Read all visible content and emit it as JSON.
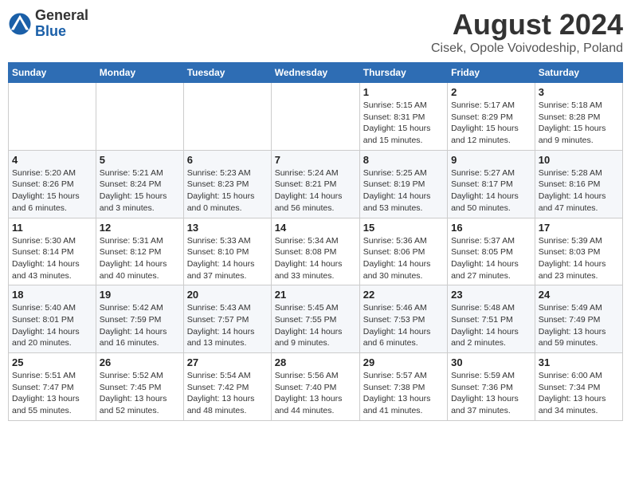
{
  "header": {
    "logo_general": "General",
    "logo_blue": "Blue",
    "main_title": "August 2024",
    "subtitle": "Cisek, Opole Voivodeship, Poland"
  },
  "calendar": {
    "days_of_week": [
      "Sunday",
      "Monday",
      "Tuesday",
      "Wednesday",
      "Thursday",
      "Friday",
      "Saturday"
    ],
    "weeks": [
      [
        {
          "day": "",
          "info": ""
        },
        {
          "day": "",
          "info": ""
        },
        {
          "day": "",
          "info": ""
        },
        {
          "day": "",
          "info": ""
        },
        {
          "day": "1",
          "info": "Sunrise: 5:15 AM\nSunset: 8:31 PM\nDaylight: 15 hours\nand 15 minutes."
        },
        {
          "day": "2",
          "info": "Sunrise: 5:17 AM\nSunset: 8:29 PM\nDaylight: 15 hours\nand 12 minutes."
        },
        {
          "day": "3",
          "info": "Sunrise: 5:18 AM\nSunset: 8:28 PM\nDaylight: 15 hours\nand 9 minutes."
        }
      ],
      [
        {
          "day": "4",
          "info": "Sunrise: 5:20 AM\nSunset: 8:26 PM\nDaylight: 15 hours\nand 6 minutes."
        },
        {
          "day": "5",
          "info": "Sunrise: 5:21 AM\nSunset: 8:24 PM\nDaylight: 15 hours\nand 3 minutes."
        },
        {
          "day": "6",
          "info": "Sunrise: 5:23 AM\nSunset: 8:23 PM\nDaylight: 15 hours\nand 0 minutes."
        },
        {
          "day": "7",
          "info": "Sunrise: 5:24 AM\nSunset: 8:21 PM\nDaylight: 14 hours\nand 56 minutes."
        },
        {
          "day": "8",
          "info": "Sunrise: 5:25 AM\nSunset: 8:19 PM\nDaylight: 14 hours\nand 53 minutes."
        },
        {
          "day": "9",
          "info": "Sunrise: 5:27 AM\nSunset: 8:17 PM\nDaylight: 14 hours\nand 50 minutes."
        },
        {
          "day": "10",
          "info": "Sunrise: 5:28 AM\nSunset: 8:16 PM\nDaylight: 14 hours\nand 47 minutes."
        }
      ],
      [
        {
          "day": "11",
          "info": "Sunrise: 5:30 AM\nSunset: 8:14 PM\nDaylight: 14 hours\nand 43 minutes."
        },
        {
          "day": "12",
          "info": "Sunrise: 5:31 AM\nSunset: 8:12 PM\nDaylight: 14 hours\nand 40 minutes."
        },
        {
          "day": "13",
          "info": "Sunrise: 5:33 AM\nSunset: 8:10 PM\nDaylight: 14 hours\nand 37 minutes."
        },
        {
          "day": "14",
          "info": "Sunrise: 5:34 AM\nSunset: 8:08 PM\nDaylight: 14 hours\nand 33 minutes."
        },
        {
          "day": "15",
          "info": "Sunrise: 5:36 AM\nSunset: 8:06 PM\nDaylight: 14 hours\nand 30 minutes."
        },
        {
          "day": "16",
          "info": "Sunrise: 5:37 AM\nSunset: 8:05 PM\nDaylight: 14 hours\nand 27 minutes."
        },
        {
          "day": "17",
          "info": "Sunrise: 5:39 AM\nSunset: 8:03 PM\nDaylight: 14 hours\nand 23 minutes."
        }
      ],
      [
        {
          "day": "18",
          "info": "Sunrise: 5:40 AM\nSunset: 8:01 PM\nDaylight: 14 hours\nand 20 minutes."
        },
        {
          "day": "19",
          "info": "Sunrise: 5:42 AM\nSunset: 7:59 PM\nDaylight: 14 hours\nand 16 minutes."
        },
        {
          "day": "20",
          "info": "Sunrise: 5:43 AM\nSunset: 7:57 PM\nDaylight: 14 hours\nand 13 minutes."
        },
        {
          "day": "21",
          "info": "Sunrise: 5:45 AM\nSunset: 7:55 PM\nDaylight: 14 hours\nand 9 minutes."
        },
        {
          "day": "22",
          "info": "Sunrise: 5:46 AM\nSunset: 7:53 PM\nDaylight: 14 hours\nand 6 minutes."
        },
        {
          "day": "23",
          "info": "Sunrise: 5:48 AM\nSunset: 7:51 PM\nDaylight: 14 hours\nand 2 minutes."
        },
        {
          "day": "24",
          "info": "Sunrise: 5:49 AM\nSunset: 7:49 PM\nDaylight: 13 hours\nand 59 minutes."
        }
      ],
      [
        {
          "day": "25",
          "info": "Sunrise: 5:51 AM\nSunset: 7:47 PM\nDaylight: 13 hours\nand 55 minutes."
        },
        {
          "day": "26",
          "info": "Sunrise: 5:52 AM\nSunset: 7:45 PM\nDaylight: 13 hours\nand 52 minutes."
        },
        {
          "day": "27",
          "info": "Sunrise: 5:54 AM\nSunset: 7:42 PM\nDaylight: 13 hours\nand 48 minutes."
        },
        {
          "day": "28",
          "info": "Sunrise: 5:56 AM\nSunset: 7:40 PM\nDaylight: 13 hours\nand 44 minutes."
        },
        {
          "day": "29",
          "info": "Sunrise: 5:57 AM\nSunset: 7:38 PM\nDaylight: 13 hours\nand 41 minutes."
        },
        {
          "day": "30",
          "info": "Sunrise: 5:59 AM\nSunset: 7:36 PM\nDaylight: 13 hours\nand 37 minutes."
        },
        {
          "day": "31",
          "info": "Sunrise: 6:00 AM\nSunset: 7:34 PM\nDaylight: 13 hours\nand 34 minutes."
        }
      ]
    ]
  }
}
